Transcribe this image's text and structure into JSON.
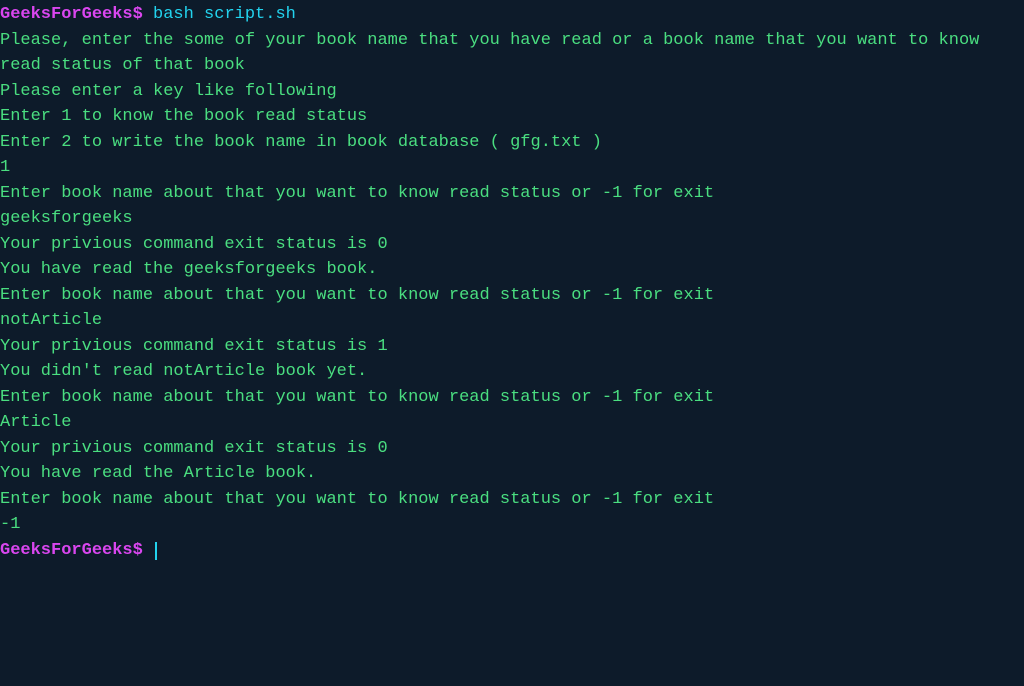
{
  "prompt1": "GeeksForGeeks$ ",
  "command1": "bash script.sh",
  "intro1": "Please, enter the some of your book name that you have read or a book name that you want to know read status of that book",
  "blank": "",
  "instrHeader": "Please enter a key like following",
  "instr1": "Enter 1 to know the book read status",
  "instr2": "Enter 2 to write the book name in book database ( gfg.txt )",
  "choice": "1",
  "promptBook1": "Enter book name about that you want to know read status or -1 for exit",
  "input1": "geeksforgeeks",
  "status1a": "Your privious command exit status is 0",
  "status1b": "You have read the geeksforgeeks book.",
  "promptBook2": "Enter book name about that you want to know read status or -1 for exit",
  "input2": "notArticle",
  "status2a": "Your privious command exit status is 1",
  "status2b": "You didn't read notArticle book yet.",
  "promptBook3": "Enter book name about that you want to know read status or -1 for exit",
  "input3": "Article",
  "status3a": "Your privious command exit status is 0",
  "status3b": "You have read the Article book.",
  "promptBook4": "Enter book name about that you want to know read status or -1 for exit",
  "input4": "-1",
  "prompt2": "GeeksForGeeks$ "
}
